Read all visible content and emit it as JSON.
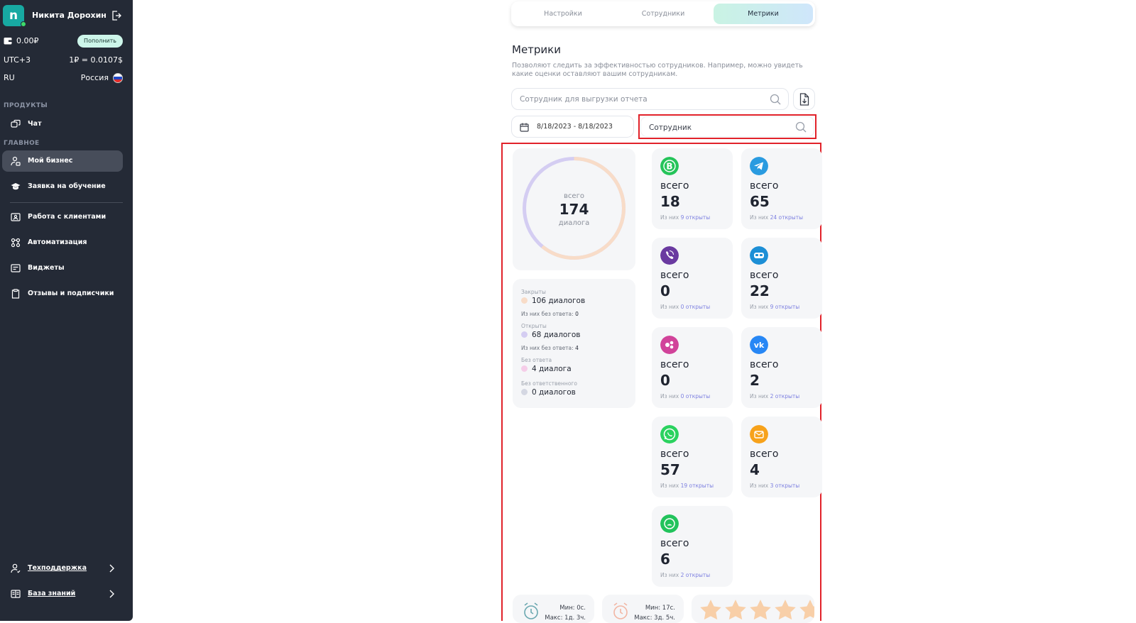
{
  "sidebar": {
    "user_initial": "n",
    "user_name": "Никита Дорохин",
    "balance": "0.00₽",
    "topup_label": "Пополнить",
    "timezone": "UTC+3",
    "rate": "1₽ = 0.0107$",
    "lang": "RU",
    "country": "Россия",
    "section_products": "ПРОДУКТЫ",
    "section_main": "ГЛАВНОЕ",
    "items": {
      "chat": "Чат",
      "business": "Мой бизнес",
      "training": "Заявка на обучение",
      "clients": "Работа с клиентами",
      "automation": "Автоматизация",
      "widgets": "Виджеты",
      "reviews": "Отзывы и подписчики",
      "support": "Техподдержка",
      "knowledge": "База знаний"
    }
  },
  "tabs": [
    "Настройки",
    "Сотрудники",
    "Метрики"
  ],
  "page": {
    "title": "Метрики",
    "description": "Позволяют следить за эффективностью сотрудников. Например, можно увидеть какие оценки оставляют вашим сотрудникам.",
    "report_search_placeholder": "Сотрудник для выгрузки отчета",
    "date_range": "8/18/2023 - 8/18/2023",
    "employee_search_placeholder": "Сотрудник"
  },
  "summary": {
    "total_label": "всего",
    "total": "174",
    "unit": "диалога",
    "closed_fraction": 0.61,
    "closed_label": "Закрыты",
    "closed_value": "106 диалогов",
    "closed_sub": "Из них без ответа:",
    "closed_sub_value": "0",
    "open_label": "Открыты",
    "open_value": "68 диалогов",
    "open_sub": "Из них без ответа:",
    "open_sub_value": "4",
    "noreply_label": "Без ответа",
    "noreply_value": "4 диалога",
    "noresp_label": "Без ответственного",
    "noresp_value": "0 диалогов",
    "colors": {
      "closed": "#f8dcc8",
      "open": "#d4cdf2",
      "noreply": "#f5cde8",
      "noresp": "#d4d7e2"
    }
  },
  "channels": [
    {
      "icon": "whatsapp-business-icon",
      "color": "#25c45a",
      "label": "всего",
      "total": "18",
      "sub": "Из них",
      "open": "9",
      "open_word": "открыты"
    },
    {
      "icon": "telegram-icon",
      "color": "#2a9be0",
      "label": "всего",
      "total": "65",
      "sub": "Из них",
      "open": "24",
      "open_word": "открыты"
    },
    {
      "icon": "viber-icon",
      "color": "#6a3aa0",
      "label": "всего",
      "total": "0",
      "sub": "Из них",
      "open": "0",
      "open_word": "открыты"
    },
    {
      "icon": "vr-headset-icon",
      "color": "#1d8fd6",
      "label": "всего",
      "total": "22",
      "sub": "Из них",
      "open": "9",
      "open_word": "открыты"
    },
    {
      "icon": "instagram-icon",
      "color": "#d1439a",
      "label": "всего",
      "total": "0",
      "sub": "Из них",
      "open": "0",
      "open_word": "открыты"
    },
    {
      "icon": "vk-icon",
      "color": "#2787f5",
      "label": "всего",
      "total": "2",
      "sub": "Из них",
      "open": "2",
      "open_word": "открыты"
    },
    {
      "icon": "whatsapp-icon",
      "color": "#2bd25f",
      "label": "всего",
      "total": "57",
      "sub": "Из них",
      "open": "19",
      "open_word": "открыты"
    },
    {
      "icon": "email-icon",
      "color": "#f7a21b",
      "label": "всего",
      "total": "4",
      "sub": "Из них",
      "open": "3",
      "open_word": "открыты"
    },
    {
      "icon": "chat-bubble-icon",
      "color": "#22c35c",
      "label": "всего",
      "total": "6",
      "sub": "Из них",
      "open": "2",
      "open_word": "открыты"
    }
  ],
  "response_times": [
    {
      "min": "Мин: 0с.",
      "max": "Макс: 1д. 3ч."
    },
    {
      "min": "Мин: 17с.",
      "max": "Макс: 3д. 5ч."
    }
  ]
}
